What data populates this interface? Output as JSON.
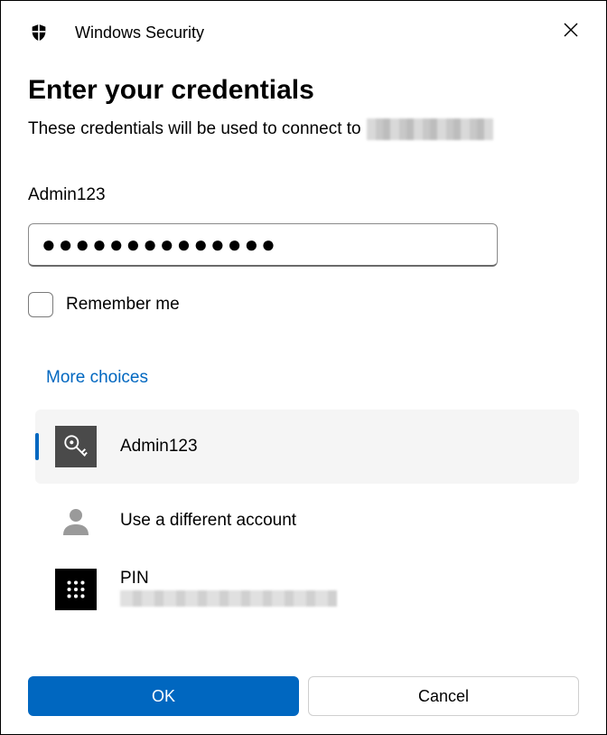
{
  "window": {
    "title": "Windows Security"
  },
  "dialog": {
    "heading": "Enter your credentials",
    "subtext": "These credentials will be used to connect to",
    "username": "Admin123",
    "password_mask": "●●●●●●●●●●●●●●",
    "remember_label": "Remember me",
    "more_choices": "More choices"
  },
  "choices": {
    "items": [
      {
        "label": "Admin123",
        "icon": "key"
      },
      {
        "label": "Use a different account",
        "icon": "user"
      },
      {
        "label": "PIN",
        "icon": "keypad"
      }
    ]
  },
  "buttons": {
    "ok": "OK",
    "cancel": "Cancel"
  }
}
